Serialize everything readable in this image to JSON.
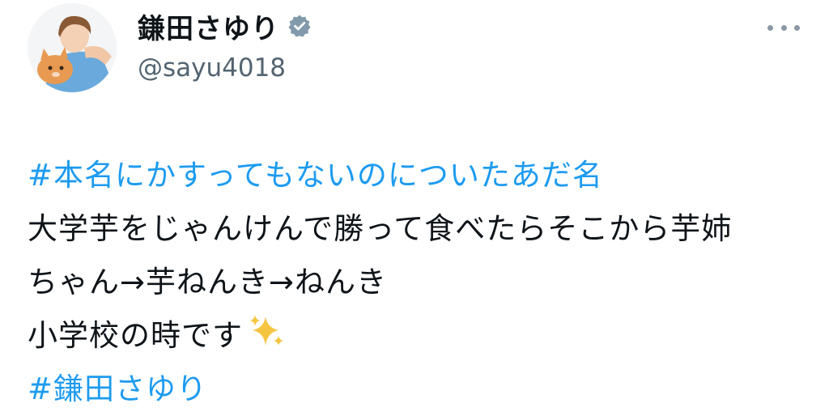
{
  "user": {
    "display_name": "鎌田さゆり",
    "handle": "@sayu4018",
    "verified": true,
    "avatar_icon": "profile-photo"
  },
  "menu": {
    "icon": "more-horizontal-icon"
  },
  "tweet": {
    "hashtag_1": "#本名にかすってもないのについたあだ名",
    "line_1": "大学芋をじゃんけんで勝って食べたらそこから芋姉",
    "line_2": "ちゃん→芋ねんき→ねんき",
    "line_3": "小学校の時です",
    "line_3_emoji": "sparkles-icon",
    "hashtag_2": "#鎌田さゆり"
  },
  "colors": {
    "link": "#1d9bf0",
    "secondary_text": "#536471",
    "verified_badge": "#829aab"
  }
}
